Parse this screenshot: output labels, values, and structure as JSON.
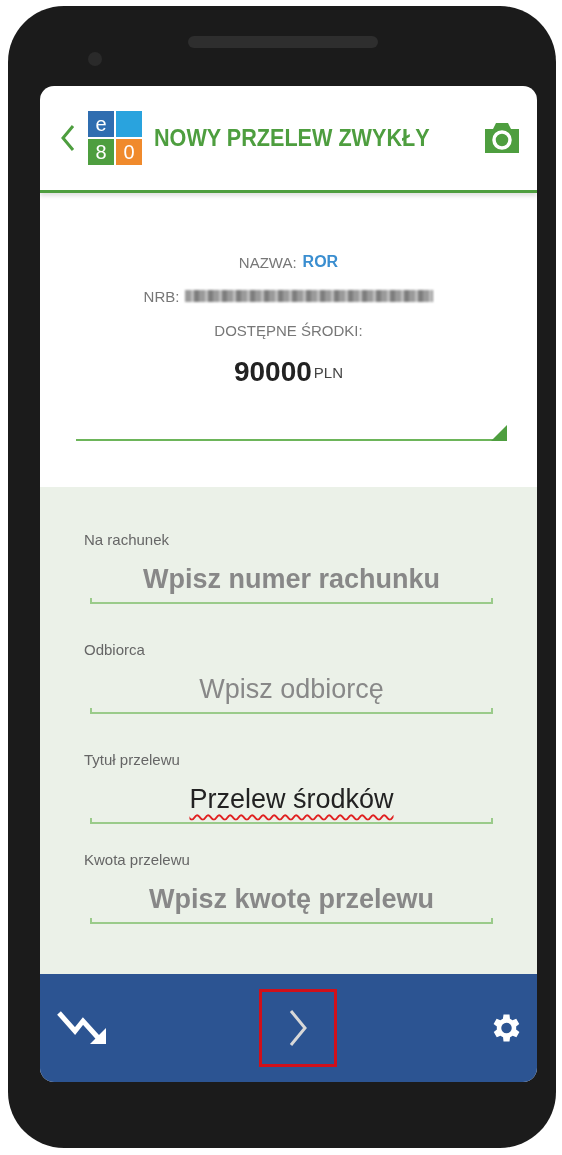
{
  "header": {
    "title": "NOWY PRZELEW ZWYKŁY",
    "logo_tiles": [
      {
        "text": "e",
        "color": "#2f6db0"
      },
      {
        "color": "#29a3de"
      },
      {
        "text": "8",
        "color": "#4e9e3f"
      },
      {
        "text": "0",
        "color": "#f08a2c"
      }
    ]
  },
  "account": {
    "name_label": "NAZWA:",
    "name_value": "ROR",
    "nrb_label": "NRB:",
    "funds_label": "DOSTĘPNE ŚRODKI:",
    "amount": "90000",
    "currency": "PLN"
  },
  "fields": [
    {
      "label": "Na rachunek",
      "placeholder": "Wpisz numer rachunku",
      "bold": true
    },
    {
      "label": "Odbiorca",
      "placeholder": "Wpisz odbiorcę",
      "bold": false
    },
    {
      "label": "Tytuł przelewu",
      "value": "Przelew środków",
      "spellcheck": true
    },
    {
      "label": "Kwota przelewu",
      "placeholder": "Wpisz kwotę przelewu",
      "bold": true
    }
  ],
  "bottom_nav": {
    "next_highlighted": true
  }
}
